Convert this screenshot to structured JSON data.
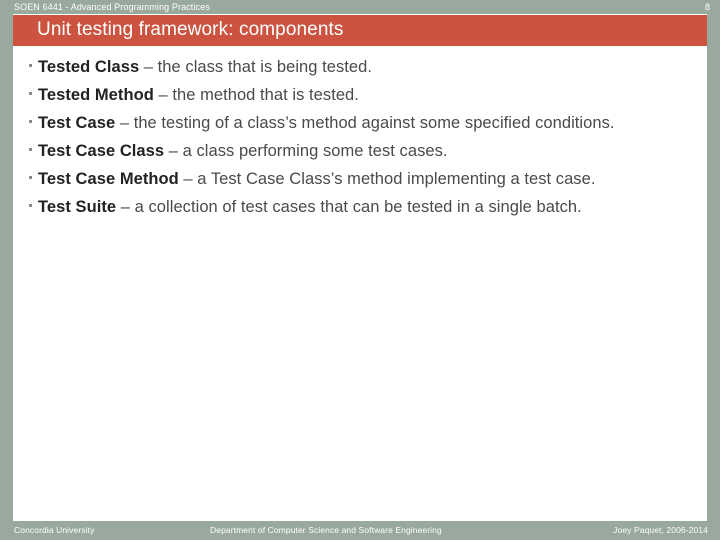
{
  "header": {
    "course": "SOEN 6441 - Advanced Programming Practices",
    "page_number": "8",
    "band_color": "#99a99e"
  },
  "title": {
    "text": "Unit testing framework: components",
    "bar_color": "#cc5340",
    "text_color": "#ffffff"
  },
  "content": {
    "bullet_marker": "square-bullet-icon",
    "bullets": [
      {
        "term": "Tested Class",
        "dash": " – ",
        "rest": "the class that is being tested."
      },
      {
        "term": "Tested Method",
        "dash": " – ",
        "rest": "the method that is tested."
      },
      {
        "term": "Test Case",
        "dash": " – ",
        "rest": "the testing of a class’s method against some specified conditions."
      },
      {
        "term": "Test Case Class",
        "dash": " – ",
        "rest": "a class performing some test cases."
      },
      {
        "term": "Test Case Method",
        "dash": " – ",
        "rest": "a Test Case Class’s method implementing a test case."
      },
      {
        "term": "Test Suite",
        "dash": " – ",
        "rest": "a collection of test cases that can be tested in a single batch."
      }
    ]
  },
  "footer": {
    "left": "Concordia University",
    "center": "Department of Computer Science and Software Engineering",
    "right": "Joey Paquet, 2006-2014",
    "band_color": "#99a99e"
  }
}
